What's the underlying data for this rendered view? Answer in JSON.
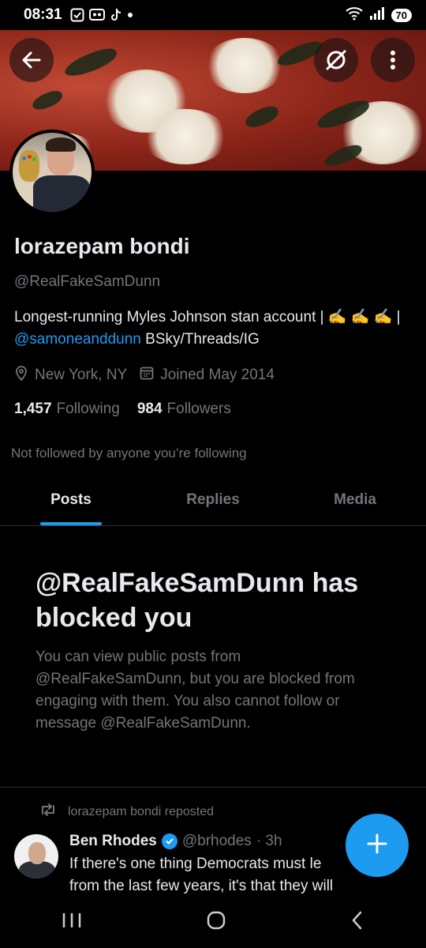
{
  "status_bar": {
    "time": "08:31",
    "battery": "70",
    "icons": [
      "checkbox-notification-icon",
      "app-notification-icon",
      "tiktok-icon",
      "dot-icon",
      "wifi-icon",
      "signal-icon"
    ]
  },
  "header": {
    "back_icon": "arrow-left-icon",
    "grok_icon": "grok-icon",
    "more_icon": "more-vertical-icon"
  },
  "profile": {
    "display_name": "lorazepam bondi",
    "handle": "@RealFakeSamDunn",
    "bio_text": "Longest-running Myles Johnson stan account | ✍️ ✍️ ✍️ |",
    "bio_link": "@samoneanddunn",
    "bio_tail": "BSky/Threads/IG",
    "location": "New York, NY",
    "joined": "Joined May 2014",
    "following_count": "1,457",
    "following_label": "Following",
    "followers_count": "984",
    "followers_label": "Followers",
    "not_followed": "Not followed by anyone you’re following"
  },
  "tabs": [
    {
      "label": "Posts",
      "active": true
    },
    {
      "label": "Replies",
      "active": false
    },
    {
      "label": "Media",
      "active": false
    }
  ],
  "blocked": {
    "title": "@RealFakeSamDunn has blocked you",
    "text": "You can view public posts from @RealFakeSamDunn, but you are blocked from engaging with them. You also cannot follow or message @RealFakeSamDunn."
  },
  "post": {
    "repost_label": "lorazepam bondi reposted",
    "author": "Ben Rhodes",
    "handle": "@brhodes",
    "time": "· 3h",
    "text_line1": "If there's one thing Democrats must le",
    "text_line2": "from the last few years, it's that they will"
  },
  "colors": {
    "accent": "#1d9bf0",
    "muted": "#71767b",
    "text": "#e7e9ea",
    "background": "#000000"
  }
}
